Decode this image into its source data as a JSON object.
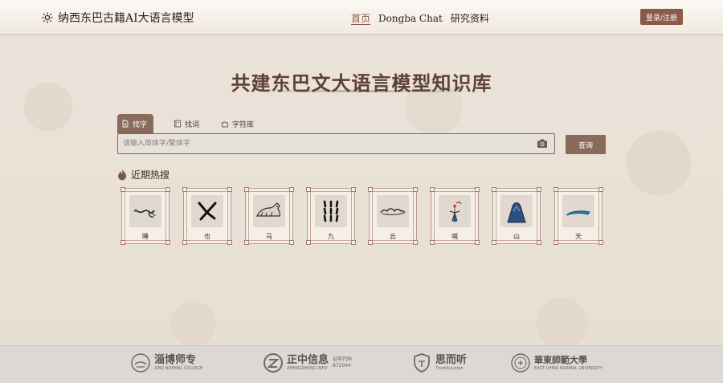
{
  "header": {
    "title": "纳西东巴古籍AI大语言模型",
    "nav": [
      {
        "label": "首页",
        "active": true
      },
      {
        "label": "Dongba Chat",
        "active": false
      },
      {
        "label": "研究资料",
        "active": false
      }
    ],
    "login_label": "登录/注册"
  },
  "hero": {
    "title": "共建东巴文大语言模型知识库"
  },
  "search": {
    "tabs": [
      {
        "label": "找字",
        "icon": "document-icon",
        "active": true
      },
      {
        "label": "找词",
        "icon": "book-icon",
        "active": false
      },
      {
        "label": "字符库",
        "icon": "puzzle-icon",
        "active": false
      }
    ],
    "placeholder": "请输入简体字/繁体字",
    "query_label": "查询"
  },
  "hot": {
    "title": "近期热搜",
    "items": [
      {
        "label": "睡"
      },
      {
        "label": "也"
      },
      {
        "label": "马"
      },
      {
        "label": "九"
      },
      {
        "label": "云"
      },
      {
        "label": "喊"
      },
      {
        "label": "山"
      },
      {
        "label": "天"
      }
    ]
  },
  "footer": {
    "logos": [
      {
        "name": "淄博师专",
        "sub": "ZIBO NORMAL COLLEGE"
      },
      {
        "name": "正中信息",
        "sub": "ZHENGZHONG INFO",
        "code_label": "证券代码",
        "code": "872044"
      },
      {
        "name": "思而听",
        "sub": "ThinkAsListen"
      },
      {
        "name": "華東師範大學",
        "sub": "EAST CHINA NORMAL UNIVERSITY"
      }
    ]
  },
  "colors": {
    "accent": "#8a5a4a",
    "tab_active": "#8a6a5a",
    "background": "#ece4da",
    "footer": "#dcd8d3"
  }
}
